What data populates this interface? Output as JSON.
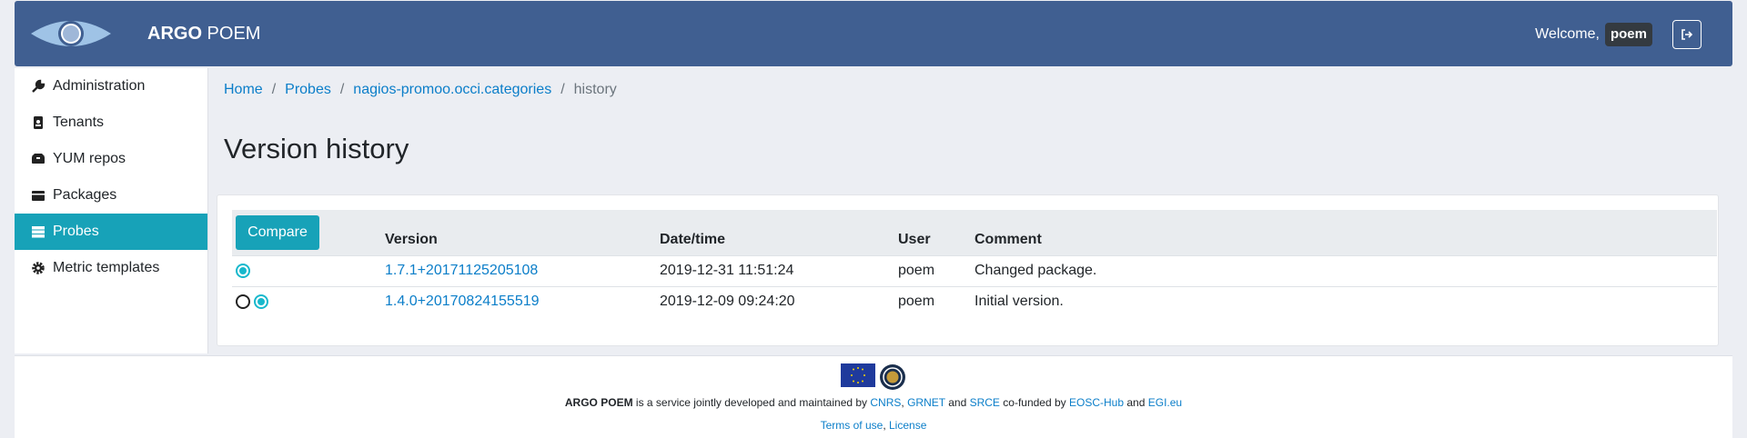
{
  "header": {
    "brand_bold": "ARGO",
    "brand_rest": " POEM",
    "welcome": "Welcome,",
    "username": "poem",
    "logout_icon": "sign-out-icon",
    "colors": {
      "bar": "#405f91",
      "accent": "#17a2b8",
      "link": "#0b7ec9"
    }
  },
  "sidebar": {
    "items": [
      {
        "label": "Administration",
        "icon": "wrench-icon",
        "active": false
      },
      {
        "label": "Tenants",
        "icon": "id-badge-icon",
        "active": false
      },
      {
        "label": "YUM repos",
        "icon": "boxes-icon",
        "active": false
      },
      {
        "label": "Packages",
        "icon": "box-icon",
        "active": false
      },
      {
        "label": "Probes",
        "icon": "server-icon",
        "active": true
      },
      {
        "label": "Metric templates",
        "icon": "cog-icon",
        "active": false
      }
    ]
  },
  "breadcrumb": {
    "items": [
      "Home",
      "Probes",
      "nagios-promoo.occi.categories"
    ],
    "current": "history",
    "separator": "/"
  },
  "page": {
    "title": "Version history"
  },
  "table": {
    "compare_label": "Compare",
    "columns": [
      "Version",
      "Date/time",
      "User",
      "Comment"
    ],
    "rows": [
      {
        "version": "1.7.1+20171125205108",
        "datetime": "2019-12-31 11:51:24",
        "user": "poem",
        "comment": "Changed package."
      },
      {
        "version": "1.4.0+20170824155519",
        "datetime": "2019-12-09 09:24:20",
        "user": "poem",
        "comment": "Initial version."
      }
    ]
  },
  "footer": {
    "brand": "ARGO POEM",
    "text1": " is a service jointly developed and maintained by ",
    "cnrs": "CNRS",
    "comma": ",",
    "grnet": "GRNET",
    "and1": " and ",
    "srce": "SRCE",
    "cofunded": " co-funded by ",
    "eosc": "EOSC-Hub",
    "and2": " and ",
    "egi": "EGI.eu",
    "terms": "Terms of use",
    "sep": ", ",
    "license": "License"
  }
}
